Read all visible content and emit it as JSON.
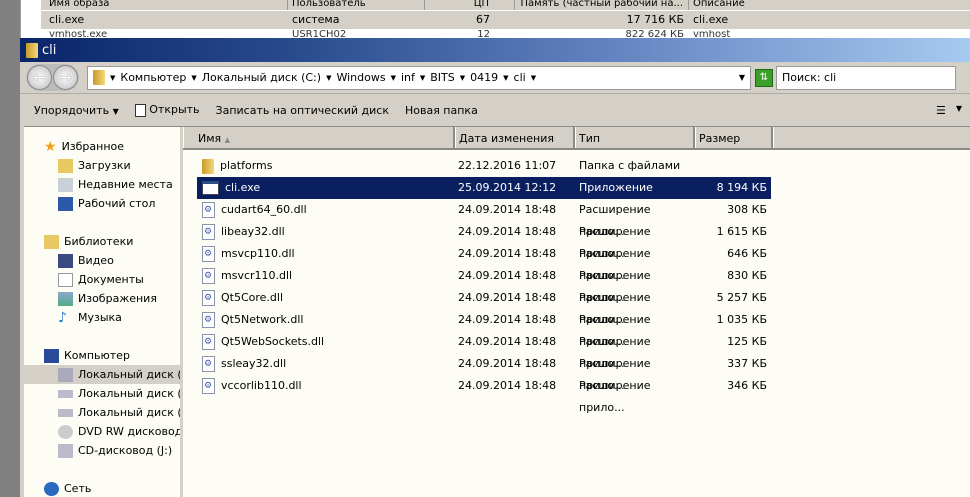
{
  "task_manager": {
    "headers": [
      "Имя образа",
      "Пользователь",
      "ЦП",
      "Память (частный рабочий на...",
      "Описание"
    ],
    "rows": [
      [
        "cli.exe",
        "система",
        "67",
        "17 716 КБ",
        "cli.exe"
      ],
      [
        "vmhost.exe",
        "USR1CH02",
        "12",
        "822 624 КБ",
        "vmhost"
      ]
    ]
  },
  "window": {
    "title": "cli"
  },
  "address": {
    "crumbs": [
      "Компьютер",
      "Локальный диск (C:)",
      "Windows",
      "inf",
      "BITS",
      "0419",
      "cli"
    ]
  },
  "search": {
    "placeholder": "Поиск: cli"
  },
  "toolbar": {
    "organize": "Упорядочить",
    "open": "Открыть",
    "burn": "Записать на оптический диск",
    "new_folder": "Новая папка"
  },
  "sidebar": {
    "favorites": {
      "label": "Избранное",
      "items": [
        "Загрузки",
        "Недавние места",
        "Рабочий стол"
      ]
    },
    "libraries": {
      "label": "Библиотеки",
      "items": [
        "Видео",
        "Документы",
        "Изображения",
        "Музыка"
      ]
    },
    "computer": {
      "label": "Компьютер",
      "items": [
        "Локальный диск (C:)",
        "Локальный диск (D:)",
        "Локальный диск (E:)",
        "DVD RW дисковод (F",
        "CD-дисковод (J:)"
      ]
    },
    "network": {
      "label": "Сеть"
    }
  },
  "columns": [
    "Имя",
    "Дата изменения",
    "Тип",
    "Размер"
  ],
  "files": [
    {
      "name": "platforms",
      "date": "22.12.2016 11:07",
      "type": "Папка с файлами",
      "size": "",
      "icon": "folder"
    },
    {
      "name": "cli.exe",
      "date": "25.09.2014 12:12",
      "type": "Приложение",
      "size": "8 194 КБ",
      "icon": "exe"
    },
    {
      "name": "cudart64_60.dll",
      "date": "24.09.2014 18:48",
      "type": "Расширение прило...",
      "size": "308 КБ",
      "icon": "dll"
    },
    {
      "name": "libeay32.dll",
      "date": "24.09.2014 18:48",
      "type": "Расширение прило...",
      "size": "1 615 КБ",
      "icon": "dll"
    },
    {
      "name": "msvcp110.dll",
      "date": "24.09.2014 18:48",
      "type": "Расширение прило...",
      "size": "646 КБ",
      "icon": "dll"
    },
    {
      "name": "msvcr110.dll",
      "date": "24.09.2014 18:48",
      "type": "Расширение прило...",
      "size": "830 КБ",
      "icon": "dll"
    },
    {
      "name": "Qt5Core.dll",
      "date": "24.09.2014 18:48",
      "type": "Расширение прило...",
      "size": "5 257 КБ",
      "icon": "dll"
    },
    {
      "name": "Qt5Network.dll",
      "date": "24.09.2014 18:48",
      "type": "Расширение прило...",
      "size": "1 035 КБ",
      "icon": "dll"
    },
    {
      "name": "Qt5WebSockets.dll",
      "date": "24.09.2014 18:48",
      "type": "Расширение прило...",
      "size": "125 КБ",
      "icon": "dll"
    },
    {
      "name": "ssleay32.dll",
      "date": "24.09.2014 18:48",
      "type": "Расширение прило...",
      "size": "337 КБ",
      "icon": "dll"
    },
    {
      "name": "vccorlib110.dll",
      "date": "24.09.2014 18:48",
      "type": "Расширение прило...",
      "size": "346 КБ",
      "icon": "dll"
    }
  ]
}
